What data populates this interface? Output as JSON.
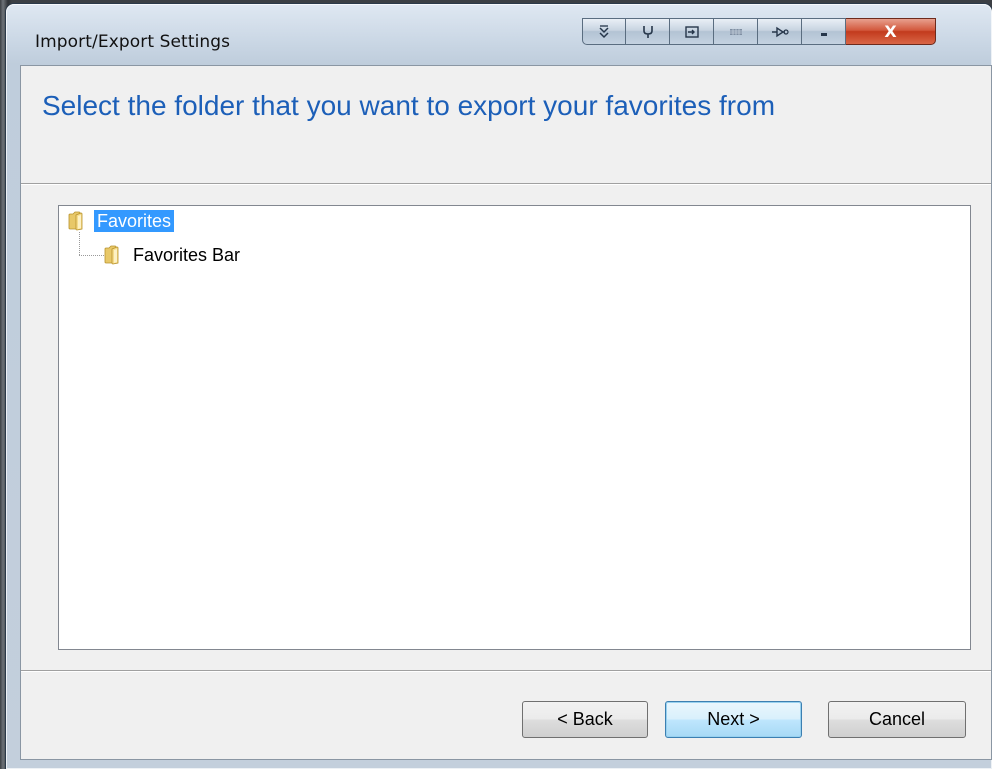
{
  "window": {
    "title": "Import/Export Settings",
    "titlebar_buttons": [
      {
        "name": "tool-1",
        "icon": "chevron-down-icon"
      },
      {
        "name": "tool-2",
        "icon": "fork-icon"
      },
      {
        "name": "tool-3",
        "icon": "enter-icon"
      },
      {
        "name": "tool-4",
        "icon": "grid-icon"
      },
      {
        "name": "tool-5",
        "icon": "pin-icon"
      }
    ],
    "minimize_label": "",
    "close_label": "X",
    "close_color": "#c23a1d"
  },
  "header": {
    "instruction": "Select the folder that you want to export your favorites from",
    "instruction_color": "#1c5fb8"
  },
  "tree": {
    "items": [
      {
        "label": "Favorites",
        "selected": true,
        "icon": "folder-icon"
      },
      {
        "label": "Favorites Bar",
        "selected": false,
        "icon": "folder-icon"
      }
    ],
    "selection_color": "#3399ff"
  },
  "footer": {
    "back_label": "< Back",
    "next_label": "Next >",
    "cancel_label": "Cancel"
  }
}
